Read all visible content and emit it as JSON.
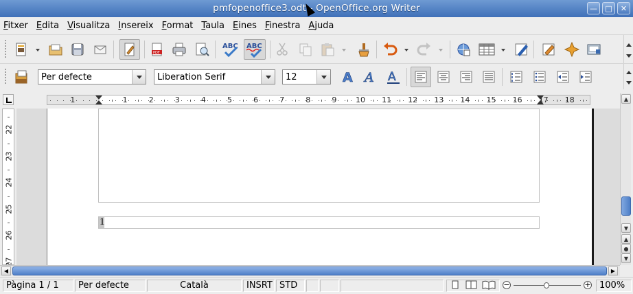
{
  "window": {
    "title": "pmfopenoffice3.odt - OpenOffice.org Writer",
    "buttons": [
      "minimize-icon",
      "maximize-icon",
      "close-icon"
    ]
  },
  "menubar": {
    "items": [
      {
        "first": "F",
        "rest": "itxer"
      },
      {
        "first": "E",
        "rest": "dita"
      },
      {
        "first": "V",
        "rest": "isualitza"
      },
      {
        "first": "I",
        "rest": "nsereix"
      },
      {
        "first": "F",
        "rest": "ormat"
      },
      {
        "first": "T",
        "rest": "aula"
      },
      {
        "first": "E",
        "rest": "ines"
      },
      {
        "first": "F",
        "rest": "inestra"
      },
      {
        "first": "A",
        "rest": "juda"
      }
    ]
  },
  "standard_toolbar": {
    "icons": [
      "new-document-icon",
      "open-icon",
      "save-icon",
      "email-icon",
      "edit-file-icon",
      "export-pdf-icon",
      "print-icon",
      "page-preview-icon",
      "spellcheck-icon",
      "autospellcheck-icon",
      "cut-icon",
      "copy-icon",
      "paste-icon",
      "clone-formatting-icon",
      "undo-icon",
      "redo-icon",
      "hyperlink-icon",
      "table-icon",
      "draw-functions-icon",
      "navigator-icon",
      "gallery-icon",
      "data-sources-icon"
    ]
  },
  "formatting_toolbar": {
    "paragraph_style": "Per defecte",
    "font_name": "Liberation Serif",
    "font_size": "12",
    "icons": [
      "styles-formatting-icon",
      "bold-icon",
      "italic-icon",
      "underline-icon",
      "align-left-icon",
      "align-center-icon",
      "align-right-icon",
      "justify-icon",
      "numbering-icon",
      "bullets-icon",
      "decrease-indent-icon",
      "increase-indent-icon"
    ]
  },
  "ruler": {
    "h_labels": [
      "1",
      "1",
      "2",
      "3",
      "4",
      "5",
      "6",
      "7",
      "8",
      "9",
      "10",
      "11",
      "12",
      "13",
      "14",
      "15",
      "16",
      "17",
      "18"
    ],
    "v_labels": [
      "22",
      "23",
      "24",
      "25",
      "26",
      "27"
    ]
  },
  "document": {
    "footer_text": "1"
  },
  "statusbar": {
    "page": "Pàgina  1 / 1",
    "style": "Per defecte",
    "language": "Català",
    "insert_mode": "INSRT",
    "selection_mode": "STD",
    "zoom": "100%"
  }
}
